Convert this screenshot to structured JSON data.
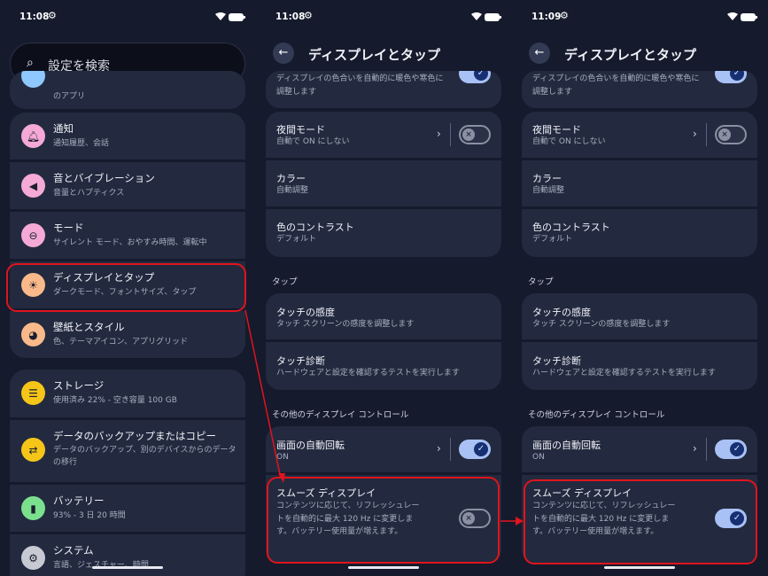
{
  "status": {
    "s1_time": "11:08",
    "s2_time": "11:08",
    "s3_time": "11:09"
  },
  "settings": {
    "search_placeholder": "設定を検索",
    "partial_sub": "のアプリ",
    "items": [
      {
        "title": "通知",
        "subtitle": "通知履歴、会話",
        "icon": "bell-icon",
        "color": "#f5a9d6"
      },
      {
        "title": "音とバイブレーション",
        "subtitle": "音量とハプティクス",
        "icon": "volume-icon",
        "color": "#f5a9d6"
      },
      {
        "title": "モード",
        "subtitle": "サイレント モード、おやすみ時間、運転中",
        "icon": "mode-icon",
        "color": "#f5a9d6"
      },
      {
        "title": "ディスプレイとタップ",
        "subtitle": "ダークモード、フォントサイズ、タップ",
        "icon": "brightness-icon",
        "color": "#f9b98a"
      },
      {
        "title": "壁紙とスタイル",
        "subtitle": "色、テーマアイコン、アプリグリッド",
        "icon": "palette-icon",
        "color": "#f9b98a"
      },
      {
        "title": "ストレージ",
        "subtitle": "使用済み 22% - 空き容量 100 GB",
        "icon": "storage-icon",
        "color": "#f5c518"
      },
      {
        "title": "データのバックアップまたはコピー",
        "subtitle": "データのバックアップ、別のデバイスからのデータの移行",
        "icon": "transfer-icon",
        "color": "#f5c518"
      },
      {
        "title": "バッテリー",
        "subtitle": "93% - 3 日 20 時間",
        "icon": "battery-icon",
        "color": "#7be08e"
      },
      {
        "title": "システム",
        "subtitle": "言語、ジェスチャー、時間",
        "icon": "gear-icon",
        "color": "#c8cad3"
      }
    ]
  },
  "display": {
    "title": "ディスプレイとタップ",
    "partial_sub": "ディスプレイの色合いを自動的に暖色や寒色に調整します",
    "night_mode": {
      "title": "夜間モード",
      "subtitle": "自動で ON にしない"
    },
    "color": {
      "title": "カラー",
      "subtitle": "自動調整"
    },
    "contrast": {
      "title": "色のコントラスト",
      "subtitle": "デフォルト"
    },
    "tap_section": "タップ",
    "touch_sensitivity": {
      "title": "タッチの感度",
      "subtitle": "タッチ スクリーンの感度を調整します"
    },
    "touch_diagnosis": {
      "title": "タッチ診断",
      "subtitle": "ハードウェアと設定を確認するテストを実行します"
    },
    "other_section": "その他のディスプレイ コントロール",
    "auto_rotate": {
      "title": "画面の自動回転",
      "subtitle": "ON"
    },
    "smooth_display": {
      "title": "スムーズ ディスプレイ",
      "subtitle": "コンテンツに応じて、リフレッシュレートを自動的に最大 120 Hz に変更します。バッテリー使用量が増えます。"
    },
    "smooth_state_before": "off",
    "smooth_state_after": "on"
  },
  "colors": {
    "highlight": "#e0141d",
    "toggle_on": "#a9c1f4",
    "background": "#151a2c"
  }
}
